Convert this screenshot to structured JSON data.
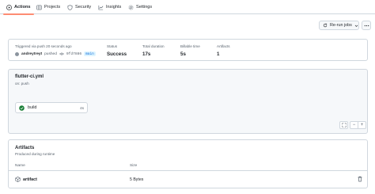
{
  "tabs": [
    {
      "label": "Actions",
      "icon": "play-icon",
      "active": true
    },
    {
      "label": "Projects",
      "icon": "table-icon",
      "active": false
    },
    {
      "label": "Security",
      "icon": "shield-icon",
      "active": false
    },
    {
      "label": "Insights",
      "icon": "graph-icon",
      "active": false
    },
    {
      "label": "Settings",
      "icon": "gear-icon",
      "active": false
    }
  ],
  "toolbar": {
    "rerun_label": "Re-run jobs"
  },
  "summary": {
    "trigger_text": "Triggered via push 20 seconds ago",
    "actor": "andreytreyt",
    "action": "pushed",
    "commit": "9fd7886",
    "branch": "main",
    "status_label": "Status",
    "status_value": "Success",
    "duration_label": "Total duration",
    "duration_value": "17s",
    "billable_label": "Billable time",
    "billable_value": "5s",
    "artifacts_label": "Artifacts",
    "artifacts_value": "1"
  },
  "workflow": {
    "file": "flutter-ci.yml",
    "trigger": "on: push",
    "job_name": "build",
    "job_time": "4s",
    "zoom_minus": "−",
    "zoom_plus": "+"
  },
  "artifacts": {
    "title": "Artifacts",
    "subtitle": "Produced during runtime",
    "col_name": "Name",
    "col_size": "Size",
    "rows": [
      {
        "name": "artifact",
        "size": "5 Bytes"
      }
    ]
  },
  "colors": {
    "accent": "#fd8c73",
    "success": "#1a7f37",
    "link": "#0969da"
  }
}
